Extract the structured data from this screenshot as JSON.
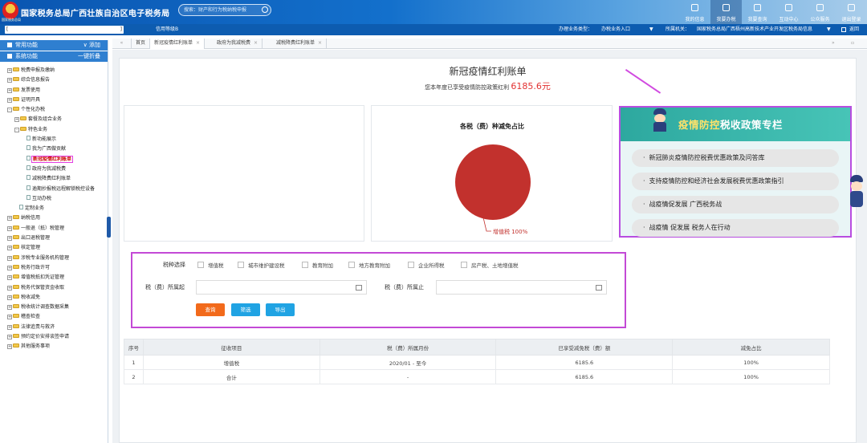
{
  "header": {
    "logo_text": "国家税务总局",
    "title": "国家税务总局广西壮族自治区电子税务局",
    "search_placeholder": "搜索：财产和行为税纳税申报",
    "nav": [
      {
        "label": "我的信息",
        "active": false
      },
      {
        "label": "我要办税",
        "active": true
      },
      {
        "label": "我要查询",
        "active": false
      },
      {
        "label": "互动中心",
        "active": false
      },
      {
        "label": "公众服务",
        "active": false
      },
      {
        "label": "退出登录",
        "active": false
      }
    ]
  },
  "subbar": {
    "taxpayer_left": "[",
    "taxpayer_right": "]",
    "credit": "信用等级B",
    "business_type_label": "办理业务类型：",
    "business_type_value": "办税业务入口",
    "agency_label": "所属机关：",
    "agency_value": "国家税务总局广西梧州高新技术产业开发区税务局信息",
    "return_label": "返回"
  },
  "sidebar": {
    "common_label": "常用功能",
    "add_label": "添加",
    "system_label": "系统功能",
    "collapse_label": "一键折叠",
    "tree": [
      {
        "label": "税费申报及缴纳",
        "level": 0,
        "type": "folder",
        "toggle": "+"
      },
      {
        "label": "综合信息报告",
        "level": 0,
        "type": "folder",
        "toggle": "+"
      },
      {
        "label": "发票使用",
        "level": 0,
        "type": "folder",
        "toggle": "+"
      },
      {
        "label": "证明开具",
        "level": 0,
        "type": "folder",
        "toggle": "+"
      },
      {
        "label": "个性化办税",
        "level": 0,
        "type": "folder",
        "toggle": "-"
      },
      {
        "label": "套餐及组合业务",
        "level": 1,
        "type": "folder",
        "toggle": "+"
      },
      {
        "label": "特色业务",
        "level": 1,
        "type": "folder",
        "toggle": "-"
      },
      {
        "label": "新功能展示",
        "level": 2,
        "type": "doc"
      },
      {
        "label": "我为广西做贡献",
        "level": 2,
        "type": "doc"
      },
      {
        "label": "新冠疫情红利账单",
        "level": 2,
        "type": "doc",
        "highlight": true
      },
      {
        "label": "政府为我减税费",
        "level": 2,
        "type": "doc"
      },
      {
        "label": "减税降费红利账单",
        "level": 2,
        "type": "doc"
      },
      {
        "label": "逾期抄报税远程解锁税控设备",
        "level": 2,
        "type": "doc"
      },
      {
        "label": "互动办税",
        "level": 2,
        "type": "doc"
      },
      {
        "label": "定制业务",
        "level": 1,
        "type": "doc"
      },
      {
        "label": "纳税信用",
        "level": 0,
        "type": "folder",
        "toggle": "+"
      },
      {
        "label": "一般退（抵）税管理",
        "level": 0,
        "type": "folder",
        "toggle": "+"
      },
      {
        "label": "出口退税管理",
        "level": 0,
        "type": "folder",
        "toggle": "+"
      },
      {
        "label": "核定管理",
        "level": 0,
        "type": "folder",
        "toggle": "+"
      },
      {
        "label": "涉税专业服务机构管理",
        "level": 0,
        "type": "folder",
        "toggle": "+"
      },
      {
        "label": "税务行政许可",
        "level": 0,
        "type": "folder",
        "toggle": "+"
      },
      {
        "label": "增值税抵扣凭证管理",
        "level": 0,
        "type": "folder",
        "toggle": "+"
      },
      {
        "label": "税务代保管资金收取",
        "level": 0,
        "type": "folder",
        "toggle": "+"
      },
      {
        "label": "税收减免",
        "level": 0,
        "type": "folder",
        "toggle": "+"
      },
      {
        "label": "税收统计调查数据采集",
        "level": 0,
        "type": "folder",
        "toggle": "+"
      },
      {
        "label": "稽查检查",
        "level": 0,
        "type": "folder",
        "toggle": "+"
      },
      {
        "label": "法律追责与救济",
        "level": 0,
        "type": "folder",
        "toggle": "+"
      },
      {
        "label": "预约定价安排谈签申请",
        "level": 0,
        "type": "folder",
        "toggle": "+"
      },
      {
        "label": "其他服务事项",
        "level": 0,
        "type": "folder",
        "toggle": "+"
      }
    ]
  },
  "tabs": {
    "home": "首页",
    "items": [
      {
        "label": "新冠疫情红利账单",
        "active": true
      },
      {
        "label": "政府为我减税费",
        "active": false
      },
      {
        "label": "减税降费红利账单",
        "active": false
      }
    ],
    "close_symbol": "×",
    "left_arrows": "«",
    "right_arrows": "»"
  },
  "page": {
    "title": "新冠疫情红利账单",
    "subtitle_prefix": "您本年度已享受疫情防控政策红利",
    "amount": "6185.6",
    "amount_unit": "元"
  },
  "chart_data": {
    "type": "pie",
    "title": "各税（费）种减免占比",
    "series": [
      {
        "name": "增值税",
        "value": 100,
        "label": "增值税 100%"
      }
    ],
    "color": "#c2312d"
  },
  "banner": {
    "title_part1": "疫情防控",
    "title_part2": "税收政策专栏",
    "items": [
      "新冠肺炎疫情防控税费优惠政策及问答库",
      "支持疫情防控和经济社会发展税费优惠政策指引",
      "战疫情促发展 广西税务战",
      "战疫情 促发展 税务人在行动"
    ]
  },
  "filter": {
    "tax_type_label": "税种选择",
    "tax_types": [
      "增值税",
      "城市维护建设税",
      "教育附加",
      "地方教育附加",
      "企业所得税",
      "房产税、土地增值税"
    ],
    "start_label": "税（费）所属起",
    "end_label": "税（费）所属止",
    "start_value": "",
    "end_value": "",
    "query_btn": "查询",
    "filter_btn": "筛选",
    "export_btn": "导出"
  },
  "table": {
    "headers": [
      "序号",
      "征收项目",
      "税（费）所属月份",
      "已享受减免税（费）额",
      "减免占比"
    ],
    "rows": [
      [
        "1",
        "增值税",
        "2020/01 - 至今",
        "6185.6",
        "100%"
      ],
      [
        "2",
        "合计",
        "-",
        "6185.6",
        "100%"
      ]
    ]
  }
}
